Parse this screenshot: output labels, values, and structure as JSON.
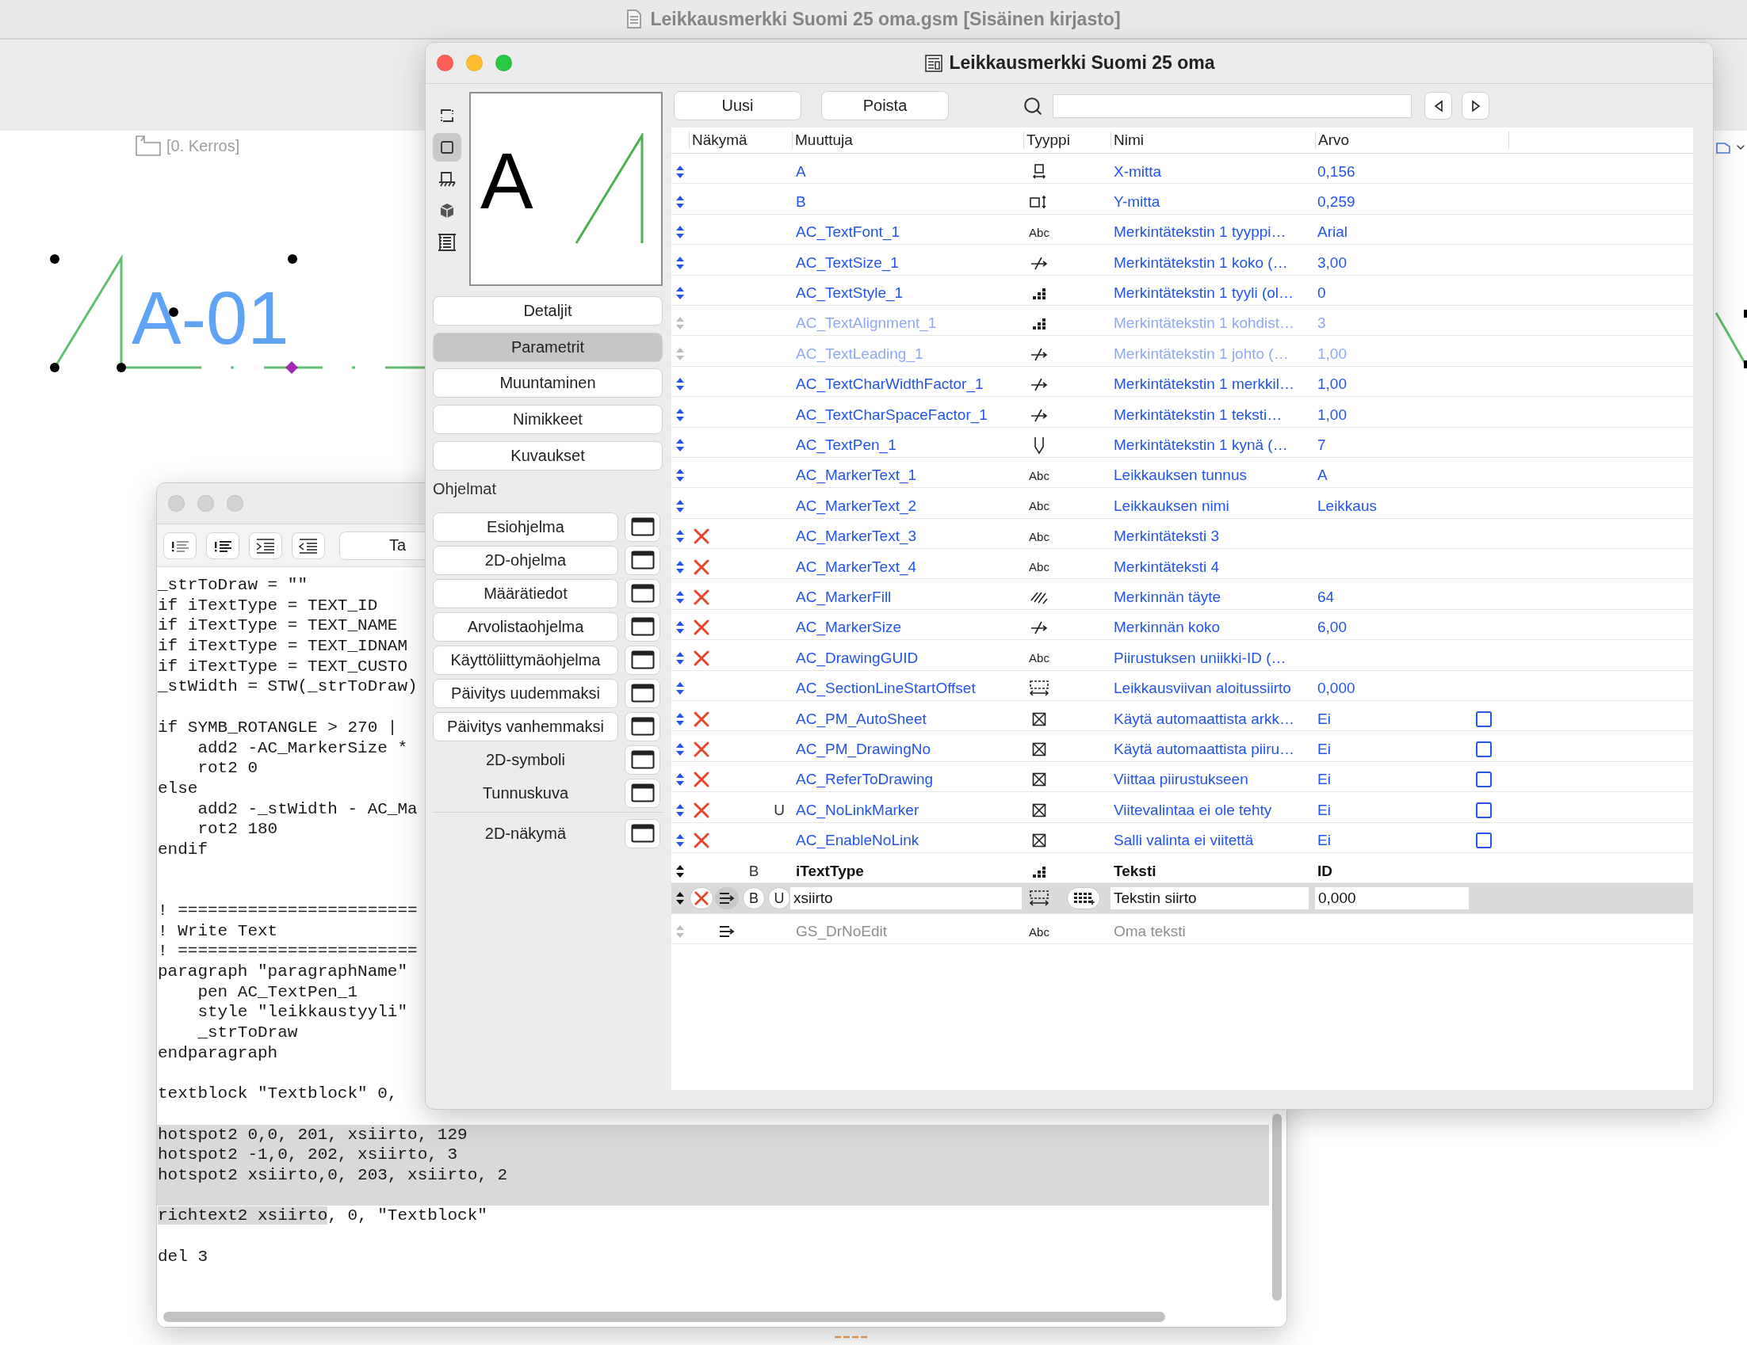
{
  "app": {
    "title": "Leikkausmerkki Suomi 25 oma.gsm [Sisäinen kirjasto]"
  },
  "canvas": {
    "level_label": "[0. Kerros]",
    "marker_text": "A-01"
  },
  "script_window": {
    "toolbar_button": "Ta",
    "lines": [
      {
        "kind": "code",
        "text": "_strToDraw = \"\"",
        "selected": false
      },
      {
        "kind": "code",
        "text": "if iTextType = TEXT_ID",
        "selected": false
      },
      {
        "kind": "code",
        "text": "if iTextType = TEXT_NAME",
        "selected": false
      },
      {
        "kind": "code",
        "text": "if iTextType = TEXT_IDNAM",
        "selected": false
      },
      {
        "kind": "code",
        "text": "if iTextType = TEXT_CUSTO",
        "selected": false
      },
      {
        "kind": "code",
        "text": "_stWidth = STW(_strToDraw)",
        "selected": false
      },
      {
        "kind": "blank",
        "selected": false
      },
      {
        "kind": "code",
        "text": "if SYMB_ROTANGLE > 270 |",
        "selected": false
      },
      {
        "kind": "code",
        "text": "    add2 -AC_MarkerSize *",
        "selected": false
      },
      {
        "kind": "code",
        "text": "    rot2 0",
        "selected": false
      },
      {
        "kind": "code",
        "text": "else",
        "selected": false
      },
      {
        "kind": "code",
        "text": "    add2 -_stWidth - AC_Ma",
        "selected": false
      },
      {
        "kind": "code",
        "text": "    rot2 180",
        "selected": false
      },
      {
        "kind": "code",
        "text": "endif",
        "selected": false
      },
      {
        "kind": "blank",
        "selected": false
      },
      {
        "kind": "blank",
        "selected": false
      },
      {
        "kind": "code",
        "text": "! ========================",
        "selected": false
      },
      {
        "kind": "code",
        "text": "! Write Text",
        "selected": false
      },
      {
        "kind": "code",
        "text": "! ========================",
        "selected": false
      },
      {
        "kind": "code",
        "text": "paragraph \"paragraphName\"",
        "selected": false
      },
      {
        "kind": "code",
        "text": "    pen AC_TextPen_1",
        "selected": false
      },
      {
        "kind": "code",
        "text": "    style \"leikkaustyyli\"",
        "selected": false
      },
      {
        "kind": "code",
        "text": "    _strToDraw",
        "selected": false
      },
      {
        "kind": "code",
        "text": "endparagraph",
        "selected": false
      },
      {
        "kind": "blank",
        "selected": false
      },
      {
        "kind": "code",
        "text": "textblock \"Textblock\" 0,",
        "selected": false
      },
      {
        "kind": "blank",
        "selected": false
      },
      {
        "kind": "code",
        "text": "hotspot2 0,0, 201, xsiirto, 129",
        "selected": true
      },
      {
        "kind": "code",
        "text": "hotspot2 -1,0, 202, xsiirto, 3",
        "selected": true
      },
      {
        "kind": "code",
        "text": "hotspot2 xsiirto,0, 203, xsiirto, 2",
        "selected": true
      },
      {
        "kind": "blank",
        "selected": true
      },
      {
        "kind": "mixed",
        "selected": false,
        "parts": [
          {
            "text": "richtext2 xsiirto",
            "selected": true
          },
          {
            "text": ", 0, \"Textblock\"",
            "selected": false
          }
        ]
      },
      {
        "kind": "blank",
        "selected": false
      },
      {
        "kind": "code",
        "text": "del 3",
        "selected": false
      }
    ]
  },
  "dialog": {
    "title": "Leikkausmerkki Suomi 25 oma",
    "view_icons": [
      {
        "kind": "frame",
        "selected": false
      },
      {
        "kind": "square",
        "selected": true
      },
      {
        "kind": "plan",
        "selected": false
      },
      {
        "kind": "cube",
        "selected": false
      },
      {
        "kind": "film",
        "selected": false
      }
    ],
    "preview": {
      "label": "A"
    },
    "sections": [
      {
        "label": "Detaljit",
        "selected": false
      },
      {
        "label": "Parametrit",
        "selected": true
      },
      {
        "label": "Muuntaminen",
        "selected": false
      },
      {
        "label": "Nimikkeet",
        "selected": false
      },
      {
        "label": "Kuvaukset",
        "selected": false
      }
    ],
    "scripts_heading": "Ohjelmat",
    "scripts": [
      {
        "label": "Esiohjelma",
        "kind": "button"
      },
      {
        "label": "2D-ohjelma",
        "kind": "button"
      },
      {
        "label": "Määrätiedot",
        "kind": "button"
      },
      {
        "label": "Arvolistaohjelma",
        "kind": "button"
      },
      {
        "label": "Käyttöliittymäohjelma",
        "kind": "button"
      },
      {
        "label": "Päivitys uudemmaksi",
        "kind": "button"
      },
      {
        "label": "Päivitys vanhemmaksi",
        "kind": "button"
      },
      {
        "label": "2D-symboli",
        "kind": "plain"
      },
      {
        "label": "Tunnuskuva",
        "kind": "plain"
      },
      {
        "label": "2D-näkymä",
        "kind": "separated"
      }
    ],
    "toolbar": {
      "buttons": [
        "Uusi",
        "Poista"
      ]
    },
    "columns": [
      "Näkymä",
      "Muuttuja",
      "Tyyppi",
      "Nimi",
      "Arvo"
    ],
    "rows": [
      {
        "name": "A",
        "type": {
          "kind": "length-x"
        },
        "label": "X-mitta",
        "value": "0,156",
        "inherited": true,
        "dimmed": false,
        "hidden": false,
        "bold": false,
        "selected": false,
        "list": false
      },
      {
        "name": "B",
        "type": {
          "kind": "length-y"
        },
        "label": "Y-mitta",
        "value": "0,259",
        "inherited": true,
        "dimmed": false,
        "hidden": false,
        "bold": false,
        "selected": false,
        "list": false
      },
      {
        "name": "AC_TextFont_1",
        "type": {
          "kind": "string",
          "label": "Abc"
        },
        "label": "Merkintätekstin 1 tyyppi…",
        "value": "Arial",
        "inherited": true,
        "dimmed": false,
        "hidden": false,
        "bold": false,
        "selected": false,
        "list": false
      },
      {
        "name": "AC_TextSize_1",
        "type": {
          "kind": "real"
        },
        "label": "Merkintätekstin 1 koko (…",
        "value": "3,00",
        "inherited": true,
        "dimmed": false,
        "hidden": false,
        "bold": false,
        "selected": false,
        "list": false
      },
      {
        "name": "AC_TextStyle_1",
        "type": {
          "kind": "integer"
        },
        "label": "Merkintätekstin 1 tyyli (ol…",
        "value": "0",
        "inherited": true,
        "dimmed": false,
        "hidden": false,
        "bold": false,
        "selected": false,
        "list": false
      },
      {
        "name": "AC_TextAlignment_1",
        "type": {
          "kind": "integer"
        },
        "label": "Merkintätekstin 1 kohdist…",
        "value": "3",
        "inherited": true,
        "dimmed": true,
        "hidden": false,
        "bold": false,
        "selected": false,
        "list": false
      },
      {
        "name": "AC_TextLeading_1",
        "type": {
          "kind": "real"
        },
        "label": "Merkintätekstin 1 johto (…",
        "value": "1,00",
        "inherited": true,
        "dimmed": true,
        "hidden": false,
        "bold": false,
        "selected": false,
        "list": false
      },
      {
        "name": "AC_TextCharWidthFactor_1",
        "type": {
          "kind": "real"
        },
        "label": "Merkintätekstin 1 merkkil…",
        "value": "1,00",
        "inherited": true,
        "dimmed": false,
        "hidden": false,
        "bold": false,
        "selected": false,
        "list": false
      },
      {
        "name": "AC_TextCharSpaceFactor_1",
        "type": {
          "kind": "real"
        },
        "label": "Merkintätekstin 1 teksti…",
        "value": "1,00",
        "inherited": true,
        "dimmed": false,
        "hidden": false,
        "bold": false,
        "selected": false,
        "list": false
      },
      {
        "name": "AC_TextPen_1",
        "type": {
          "kind": "pen"
        },
        "label": "Merkintätekstin 1 kynä (…",
        "value": "7",
        "inherited": true,
        "dimmed": false,
        "hidden": false,
        "bold": false,
        "selected": false,
        "list": false
      },
      {
        "name": "AC_MarkerText_1",
        "type": {
          "kind": "string",
          "label": "Abc"
        },
        "label": "Leikkauksen tunnus",
        "value": "A",
        "inherited": true,
        "dimmed": false,
        "hidden": false,
        "bold": false,
        "selected": false,
        "list": false
      },
      {
        "name": "AC_MarkerText_2",
        "type": {
          "kind": "string",
          "label": "Abc"
        },
        "label": "Leikkauksen nimi",
        "value": "Leikkaus",
        "inherited": true,
        "dimmed": false,
        "hidden": false,
        "bold": false,
        "selected": false,
        "list": false
      },
      {
        "name": "AC_MarkerText_3",
        "type": {
          "kind": "string",
          "label": "Abc"
        },
        "label": "Merkintäteksti 3",
        "inherited": true,
        "dimmed": false,
        "hidden": true,
        "bold": false,
        "selected": false,
        "list": false
      },
      {
        "name": "AC_MarkerText_4",
        "type": {
          "kind": "string",
          "label": "Abc"
        },
        "label": "Merkintäteksti 4",
        "inherited": true,
        "dimmed": false,
        "hidden": true,
        "bold": false,
        "selected": false,
        "list": false
      },
      {
        "name": "AC_MarkerFill",
        "type": {
          "kind": "fill"
        },
        "label": "Merkinnän täyte",
        "value": "64",
        "inherited": true,
        "dimmed": false,
        "hidden": true,
        "bold": false,
        "selected": false,
        "list": false
      },
      {
        "name": "AC_MarkerSize",
        "type": {
          "kind": "real"
        },
        "label": "Merkinnän koko",
        "value": "6,00",
        "inherited": true,
        "dimmed": false,
        "hidden": true,
        "bold": false,
        "selected": false,
        "list": false
      },
      {
        "name": "AC_DrawingGUID",
        "type": {
          "kind": "string",
          "label": "Abc"
        },
        "label": "Piirustuksen uniikki-ID (…",
        "inherited": true,
        "dimmed": false,
        "hidden": true,
        "bold": false,
        "selected": false,
        "list": false
      },
      {
        "name": "AC_SectionLineStartOffset",
        "type": {
          "kind": "offset"
        },
        "label": "Leikkausviivan aloitussiirto",
        "value": "0,000",
        "inherited": true,
        "dimmed": false,
        "hidden": false,
        "bold": false,
        "selected": false,
        "list": false
      },
      {
        "name": "AC_PM_AutoSheet",
        "type": {
          "kind": "boolean"
        },
        "label": "Käytä automaattista arkk…",
        "value": "Ei",
        "checked": false,
        "inherited": true,
        "dimmed": false,
        "hidden": true,
        "bold": false,
        "selected": false,
        "list": false
      },
      {
        "name": "AC_PM_DrawingNo",
        "type": {
          "kind": "boolean"
        },
        "label": "Käytä automaattista piiru…",
        "value": "Ei",
        "checked": false,
        "inherited": true,
        "dimmed": false,
        "hidden": true,
        "bold": false,
        "selected": false,
        "list": false
      },
      {
        "name": "AC_ReferToDrawing",
        "type": {
          "kind": "boolean"
        },
        "label": "Viittaa piirustukseen",
        "value": "Ei",
        "checked": false,
        "inherited": true,
        "dimmed": false,
        "hidden": true,
        "bold": false,
        "selected": false,
        "list": false
      },
      {
        "name": "AC_NoLinkMarker",
        "type": {
          "kind": "boolean"
        },
        "label": "Viitevalintaa ei ole tehty",
        "value": "Ei",
        "checked": false,
        "inherited": true,
        "dimmed": false,
        "hidden": true,
        "bold": false,
        "selected": false,
        "list": false,
        "flags": [
          {
            "kind": "unique",
            "label": "U"
          }
        ]
      },
      {
        "name": "AC_EnableNoLink",
        "type": {
          "kind": "boolean"
        },
        "label": "Salli valinta ei viitettä",
        "value": "Ei",
        "checked": false,
        "inherited": true,
        "dimmed": false,
        "hidden": true,
        "bold": false,
        "selected": false,
        "list": false
      },
      {
        "name": "iTextType",
        "type": {
          "kind": "integer"
        },
        "label": "Teksti",
        "value": "ID",
        "inherited": false,
        "dimmed": false,
        "hidden": false,
        "bold": true,
        "selected": false,
        "list": false,
        "flags": [
          {
            "kind": "bold",
            "label": "B"
          }
        ]
      },
      {
        "name": "xsiirto",
        "type": {
          "kind": "offset"
        },
        "label": "Tekstin siirto",
        "value": "0,000",
        "inherited": false,
        "dimmed": false,
        "hidden": true,
        "bold": false,
        "selected": true,
        "list": true,
        "flags": [
          {
            "kind": "bold",
            "label": "B"
          },
          {
            "kind": "unique",
            "label": "U"
          }
        ]
      },
      {
        "name": "GS_DrNoEdit",
        "type": {
          "kind": "string",
          "label": "Abc"
        },
        "label": "Oma teksti",
        "inherited": false,
        "dimmed": true,
        "hidden": false,
        "bold": false,
        "selected": false,
        "list": true
      }
    ]
  }
}
